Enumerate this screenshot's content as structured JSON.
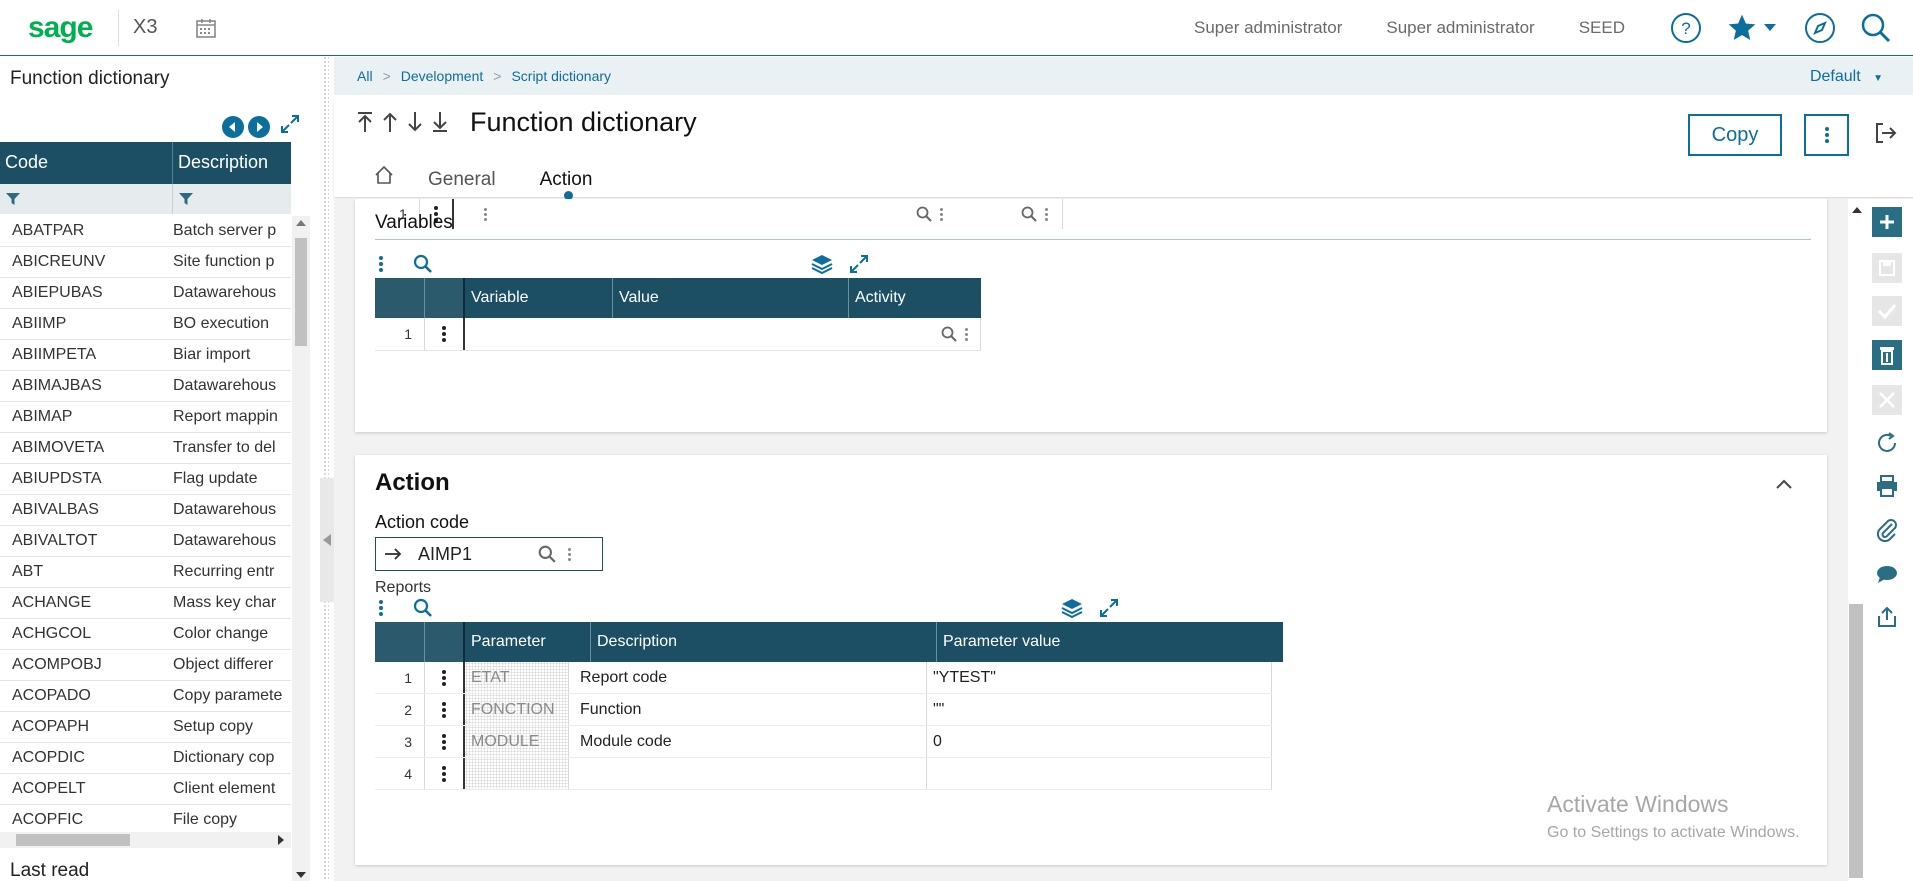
{
  "topbar": {
    "logo": "sage",
    "product": "X3",
    "user1": "Super administrator",
    "user2": "Super administrator",
    "folder": "SEED",
    "icons": [
      "calendar-icon",
      "help-icon",
      "star-icon",
      "chevron-down-icon",
      "compass-icon",
      "search-icon"
    ]
  },
  "left_panel": {
    "title": "Function dictionary",
    "columns": [
      "Code",
      "Description"
    ],
    "rows": [
      {
        "code": "ABATPAR",
        "desc": "Batch server p"
      },
      {
        "code": "ABICREUNV",
        "desc": "Site function p"
      },
      {
        "code": "ABIEPUBAS",
        "desc": "Datawarehous"
      },
      {
        "code": "ABIIMP",
        "desc": "BO execution"
      },
      {
        "code": "ABIIMPETA",
        "desc": "Biar import"
      },
      {
        "code": "ABIMAJBAS",
        "desc": "Datawarehous"
      },
      {
        "code": "ABIMAP",
        "desc": "Report mappin"
      },
      {
        "code": "ABIMOVETA",
        "desc": "Transfer to del"
      },
      {
        "code": "ABIUPDSTA",
        "desc": "Flag update"
      },
      {
        "code": "ABIVALBAS",
        "desc": "Datawarehous"
      },
      {
        "code": "ABIVALTOT",
        "desc": "Datawarehous"
      },
      {
        "code": "ABT",
        "desc": "Recurring entr"
      },
      {
        "code": "ACHANGE",
        "desc": "Mass key char"
      },
      {
        "code": "ACHGCOL",
        "desc": "Color change"
      },
      {
        "code": "ACOMPOBJ",
        "desc": "Object differer"
      },
      {
        "code": "ACOPADO",
        "desc": "Copy paramete"
      },
      {
        "code": "ACOPAPH",
        "desc": "Setup copy"
      },
      {
        "code": "ACOPDIC",
        "desc": "Dictionary cop"
      },
      {
        "code": "ACOPELT",
        "desc": "Client element"
      },
      {
        "code": "ACOPFIC",
        "desc": "File copy"
      }
    ],
    "footer": "Last read"
  },
  "breadcrumb": {
    "items": [
      "All",
      "Development",
      "Script dictionary"
    ],
    "default": "Default"
  },
  "header": {
    "title": "Function dictionary",
    "copy_label": "Copy",
    "tabs": [
      "General",
      "Action"
    ]
  },
  "top_row": {
    "num": "1"
  },
  "variables": {
    "title": "Variables",
    "columns": [
      "Variable",
      "Value",
      "Activity"
    ],
    "rows": [
      {
        "num": "1"
      }
    ]
  },
  "action": {
    "title": "Action",
    "code_label": "Action code",
    "code_value": "AIMP1",
    "reports_label": "Reports",
    "columns": [
      "Parameter",
      "Description",
      "Parameter value"
    ],
    "rows": [
      {
        "num": "1",
        "param": "ETAT",
        "desc": "Report code",
        "value": "\"YTEST\""
      },
      {
        "num": "2",
        "param": "FONCTION",
        "desc": "Function",
        "value": "\"\""
      },
      {
        "num": "3",
        "param": "MODULE",
        "desc": "Module code",
        "value": "0"
      },
      {
        "num": "4",
        "param": "",
        "desc": "",
        "value": ""
      }
    ]
  },
  "watermark": {
    "line1": "Activate Windows",
    "line2": "Go to Settings to activate Windows."
  },
  "colors": {
    "accent": "#0b6e9c",
    "grid_header": "#1c4f63",
    "logo": "#00b050"
  }
}
